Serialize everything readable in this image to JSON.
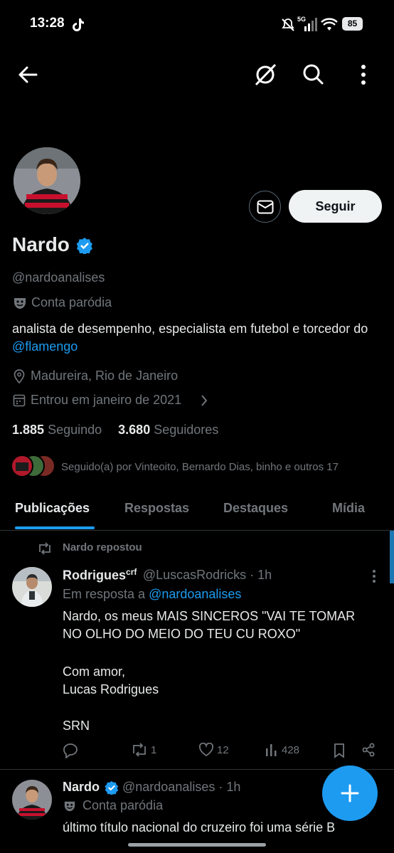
{
  "status_bar": {
    "time": "13:28",
    "network": "5G",
    "battery": "85"
  },
  "profile": {
    "name": "Nardo",
    "handle": "@nardoanalises",
    "parody_label": "Conta paródia",
    "bio_text": "analista de desempenho, especialista em futebol e torcedor do ",
    "bio_mention": "@flamengo",
    "location": "Madureira, Rio de Janeiro",
    "joined": "Entrou em janeiro de 2021",
    "following_count": "1.885",
    "following_label": "Seguindo",
    "followers_count": "3.680",
    "followers_label": "Seguidores",
    "followed_by": "Seguido(a) por Vinteoito, Bernardo Dias, binho e outros 17",
    "follow_button": "Seguir"
  },
  "tabs": [
    {
      "label": "Publicações",
      "active": true
    },
    {
      "label": "Respostas",
      "active": false
    },
    {
      "label": "Destaques",
      "active": false
    },
    {
      "label": "Mídia",
      "active": false
    }
  ],
  "posts": [
    {
      "repost_label": "Nardo repostou",
      "name": "Rodrigues",
      "name_sup": "crf",
      "handle_time": "@LuscasRodricks · 1h",
      "reply_prefix": "Em resposta a ",
      "reply_to": "@nardoanalises",
      "lines": [
        "Nardo, os meus MAIS SINCEROS \"VAI TE TOMAR",
        "NO OLHO DO MEIO DO TEU CU ROXO\"",
        "Com amor,",
        "Lucas Rodrigues",
        "SRN"
      ],
      "reposts": "1",
      "likes": "12",
      "views": "428"
    },
    {
      "name": "Nardo",
      "handle_time": "@nardoanalises · 1h",
      "parody_label": "Conta paródia",
      "text": "último título nacional do cruzeiro foi uma série B"
    }
  ],
  "colors": {
    "accent": "#1d9bf0",
    "background": "#000000",
    "muted": "#71767b"
  }
}
